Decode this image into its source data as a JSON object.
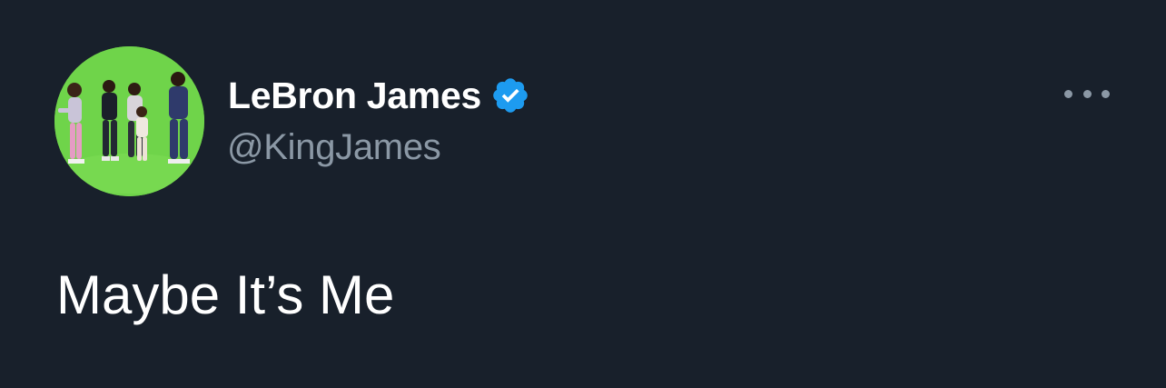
{
  "author": {
    "display_name": "LeBron James",
    "handle": "@KingJames",
    "verified": true,
    "avatar_icon": "group-photo-avatar"
  },
  "tweet": {
    "text": "Maybe It’s Me"
  },
  "actions": {
    "more_icon": "more-horizontal-icon"
  },
  "colors": {
    "background": "#18202b",
    "primary_text": "#ffffff",
    "secondary_text": "#8b98a5",
    "verified_badge": "#1d9bf0",
    "avatar_background": "#6fd44a"
  }
}
